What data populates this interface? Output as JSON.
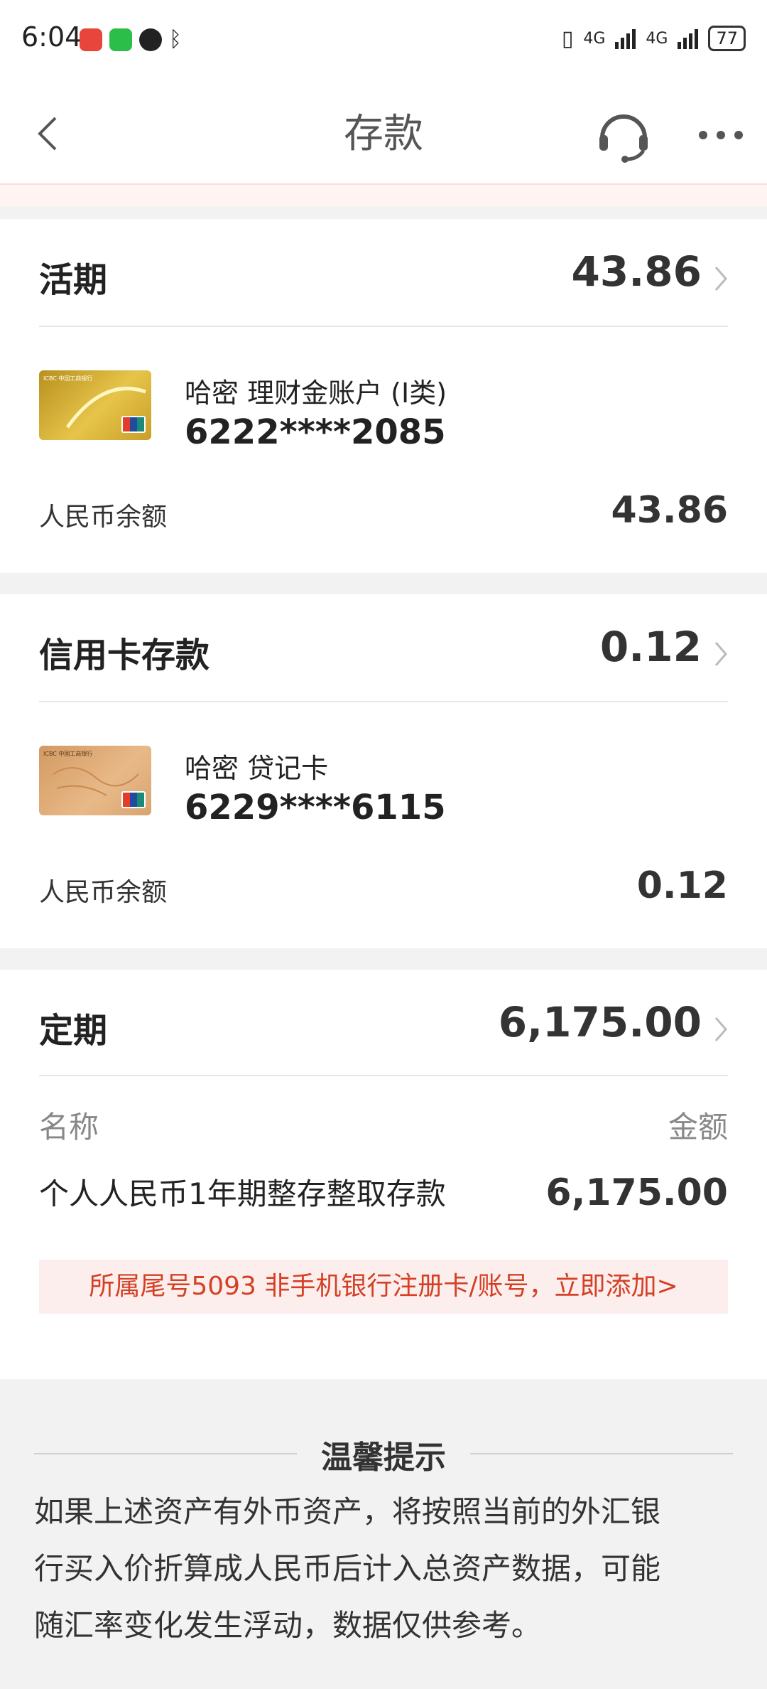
{
  "status_bar": {
    "time": "6:04",
    "signal1": "4G",
    "signal2": "4G",
    "battery": "77"
  },
  "nav": {
    "title": "存款"
  },
  "current": {
    "title": "活期",
    "total": "43.86",
    "account_name": "哈密 理财金账户 (I类)",
    "account_number": "6222****2085",
    "balance_label": "人民币余额",
    "balance": "43.86"
  },
  "credit": {
    "title": "信用卡存款",
    "total": "0.12",
    "account_name": "哈密 贷记卡",
    "account_number": "6229****6115",
    "balance_label": "人民币余额",
    "balance": "0.12"
  },
  "fixed": {
    "title": "定期",
    "total": "6,175.00",
    "col_name": "名称",
    "col_amount": "金额",
    "items": [
      {
        "name": "个人人民币1年期整存整取存款",
        "amount": "6,175.00"
      }
    ],
    "notice": "所属尾号5093 非手机银行注册卡/账号，立即添加>"
  },
  "tips": {
    "title": "温馨提示",
    "line1": "如果上述资产有外币资产，将按照当前的外汇银",
    "line2": "行买入价折算成人民币后计入总资产数据，可能",
    "line3": "随汇率变化发生浮动，数据仅供参考。"
  },
  "colors": {
    "accent_red": "#d44024",
    "card_gold": "#d9b23a",
    "card_tan": "#e0ad7a"
  }
}
